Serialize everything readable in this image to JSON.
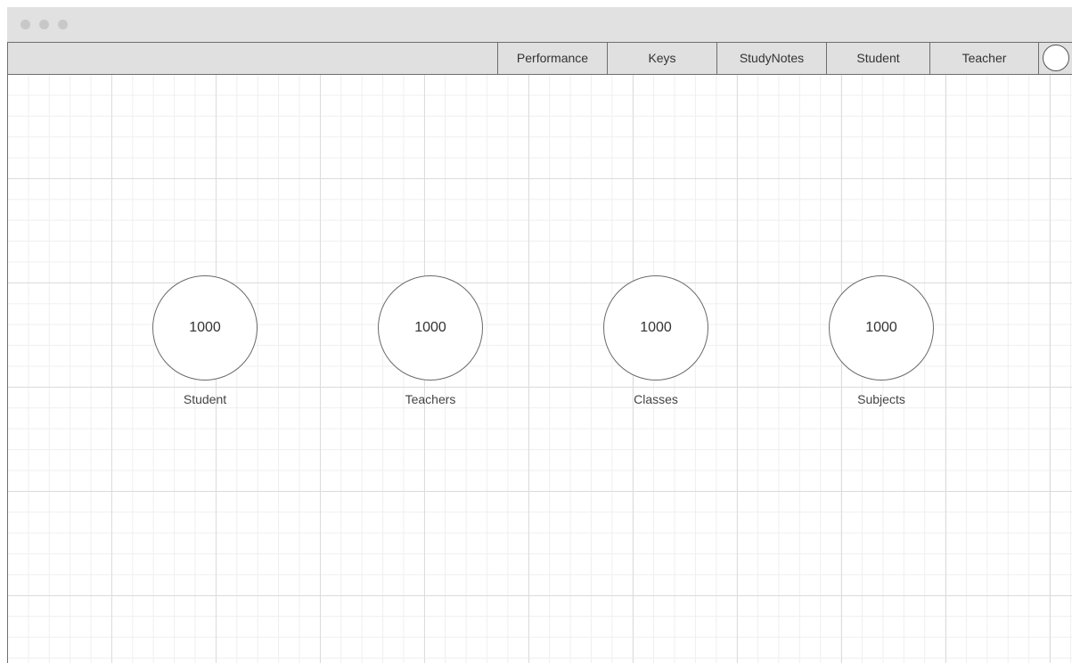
{
  "nav": {
    "items": [
      {
        "label": "Performance"
      },
      {
        "label": "Keys"
      },
      {
        "label": "StudyNotes"
      },
      {
        "label": "Student"
      },
      {
        "label": "Teacher"
      }
    ]
  },
  "stats": [
    {
      "value": "1000",
      "label": "Student"
    },
    {
      "value": "1000",
      "label": "Teachers"
    },
    {
      "value": "1000",
      "label": "Classes"
    },
    {
      "value": "1000",
      "label": "Subjects"
    }
  ]
}
